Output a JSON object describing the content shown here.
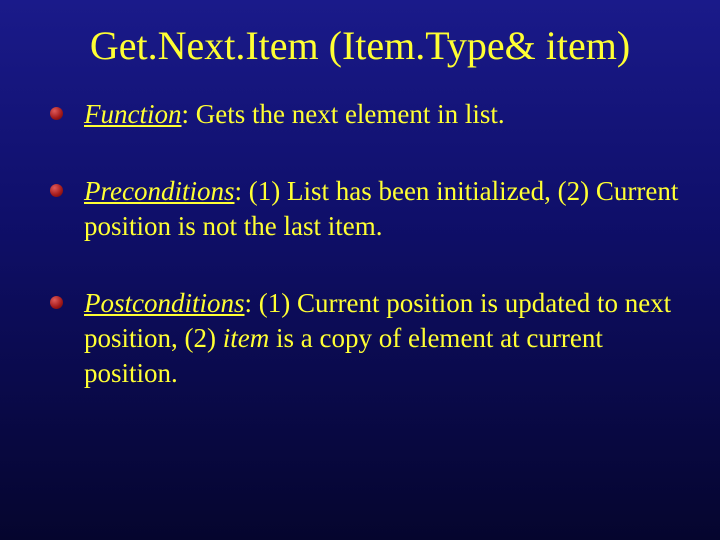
{
  "title": "Get.Next.Item (Item.Type& item)",
  "items": [
    {
      "label": "Function",
      "text": ": Gets the next element in list."
    },
    {
      "label": "Preconditions",
      "text": ": (1) List has been initialized, (2) Current position is not the last item."
    },
    {
      "label": "Postconditions",
      "text_a": ": (1) Current position is updated to next position, (2) ",
      "italic_word": "item",
      "text_b": " is a copy of element at current position."
    }
  ]
}
